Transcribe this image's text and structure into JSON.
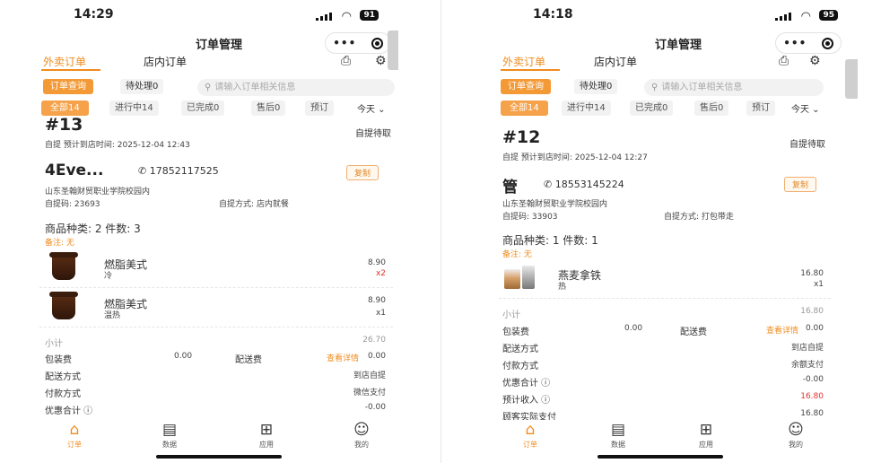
{
  "screens": [
    {
      "status": {
        "time": "14:29",
        "battery": "91"
      },
      "nav_title": "订单管理",
      "tabs": {
        "delivery": "外卖订单",
        "dinein": "店内订单"
      },
      "filter": {
        "query_btn": "订单查询",
        "pending": "待处理0",
        "search_placeholder": "请输入订单相关信息"
      },
      "status_pills": {
        "all": "全部14",
        "ongoing": "进行中14",
        "done": "已完成0",
        "aftersale": "售后0",
        "reserve": "预订",
        "date": "今天"
      },
      "order": {
        "number": "#13",
        "pickup_status": "自提待取",
        "est_time": "自提  预计到店时间: 2025-12-04 12:43",
        "customer": "4Eve...",
        "phone": "17852117525",
        "copy": "复制",
        "address": "山东圣翰财贸职业学院校园内",
        "pickup_code": "自提码: 23693",
        "pickup_mode": "自提方式: 店内就餐",
        "counts": "商品种类: 2   件数: 3",
        "remark": "备注: 无",
        "items": [
          {
            "name": "燃脂美式",
            "spec": "冷",
            "price": "8.90",
            "qty": "x2"
          },
          {
            "name": "燃脂美式",
            "spec": "温热",
            "price": "8.90",
            "qty": "x1"
          }
        ],
        "subtotal_label": "小计",
        "subtotal": "26.70",
        "pack_label": "包装费",
        "pack_value": "0.00",
        "delivery_fee_label": "配送费",
        "detail_link": "查看详情",
        "delivery_fee_value": "0.00",
        "rows": [
          {
            "label": "配送方式",
            "value": "到店自提"
          },
          {
            "label": "付款方式",
            "value": "微信支付"
          },
          {
            "label": "优惠合计 ⓘ",
            "value": "-0.00"
          }
        ]
      }
    },
    {
      "status": {
        "time": "14:18",
        "battery": "95"
      },
      "nav_title": "订单管理",
      "tabs": {
        "delivery": "外卖订单",
        "dinein": "店内订单"
      },
      "filter": {
        "query_btn": "订单查询",
        "pending": "待处理0",
        "search_placeholder": "请输入订单相关信息"
      },
      "status_pills": {
        "all": "全部14",
        "ongoing": "进行中14",
        "done": "已完成0",
        "aftersale": "售后0",
        "reserve": "预订",
        "date": "今天"
      },
      "order": {
        "number": "#12",
        "pickup_status": "自提待取",
        "est_time": "自提  预计到店时间: 2025-12-04 12:27",
        "customer": "管",
        "phone": "18553145224",
        "copy": "复制",
        "address": "山东圣翰财贸职业学院校园内",
        "pickup_code": "自提码: 33903",
        "pickup_mode": "自提方式: 打包带走",
        "counts": "商品种类: 1   件数: 1",
        "remark": "备注: 无",
        "items": [
          {
            "name": "燕麦拿铁",
            "spec": "热",
            "price": "16.80",
            "qty": "x1"
          }
        ],
        "subtotal_label": "小计",
        "subtotal": "16.80",
        "pack_label": "包装费",
        "pack_value": "0.00",
        "delivery_fee_label": "配送费",
        "detail_link": "查看详情",
        "delivery_fee_value": "0.00",
        "rows": [
          {
            "label": "配送方式",
            "value": "到店自提"
          },
          {
            "label": "付款方式",
            "value": "余额支付"
          },
          {
            "label": "优惠合计 ⓘ",
            "value": "-0.00"
          },
          {
            "label": "预计收入 ⓘ",
            "value": "16.80"
          },
          {
            "label": "顾客实际支付",
            "value": "16.80"
          }
        ]
      }
    }
  ],
  "tabbar": [
    {
      "label": "订单",
      "icon": "home-icon"
    },
    {
      "label": "数据",
      "icon": "data-icon"
    },
    {
      "label": "应用",
      "icon": "apps-icon"
    },
    {
      "label": "我的",
      "icon": "profile-icon"
    }
  ],
  "colors": {
    "accent": "#f08c1e",
    "price_red": "#e0312e"
  }
}
